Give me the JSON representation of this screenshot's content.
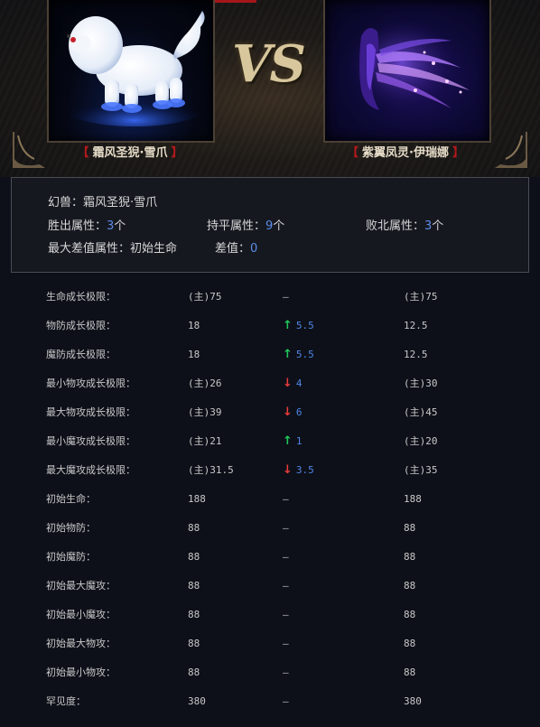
{
  "header": {
    "vs_text": "VS",
    "left_pet": {
      "bracket_open": "【",
      "name": "霜风圣猊·雪爪",
      "bracket_close": "】"
    },
    "right_pet": {
      "bracket_open": "【",
      "name": "紫翼凤灵·伊瑞娜",
      "bracket_close": "】"
    },
    "colors": {
      "bracket": "#b3181c",
      "name": "#e6dcc8",
      "vs": "#d8c79d"
    }
  },
  "summary": {
    "pet_label": "幻兽：",
    "pet_name": "霜风圣猊·雪爪",
    "win_label": "胜出属性：",
    "win_count": "3",
    "win_unit": "个",
    "tie_label": "持平属性：",
    "tie_count": "9",
    "tie_unit": "个",
    "lose_label": "败北属性：",
    "lose_count": "3",
    "lose_unit": "个",
    "max_diff_label": "最大差值属性：",
    "max_diff_attr": "初始生命",
    "diff_label": "差值：",
    "diff_value": "0"
  },
  "stats": [
    {
      "label": "生命成长极限：",
      "left": "(主)75",
      "dir": "",
      "diff": "–",
      "right": "(主)75"
    },
    {
      "label": "物防成长极限：",
      "left": "18",
      "dir": "up",
      "diff": "5.5",
      "right": "12.5"
    },
    {
      "label": "魔防成长极限：",
      "left": "18",
      "dir": "up",
      "diff": "5.5",
      "right": "12.5"
    },
    {
      "label": "最小物攻成长极限：",
      "left": "(主)26",
      "dir": "down",
      "diff": "4",
      "right": "(主)30"
    },
    {
      "label": "最大物攻成长极限：",
      "left": "(主)39",
      "dir": "down",
      "diff": "6",
      "right": "(主)45"
    },
    {
      "label": "最小魔攻成长极限：",
      "left": "(主)21",
      "dir": "up",
      "diff": "1",
      "right": "(主)20"
    },
    {
      "label": "最大魔攻成长极限：",
      "left": "(主)31.5",
      "dir": "down",
      "diff": "3.5",
      "right": "(主)35"
    },
    {
      "label": "初始生命：",
      "left": "188",
      "dir": "",
      "diff": "–",
      "right": "188"
    },
    {
      "label": "初始物防：",
      "left": "88",
      "dir": "",
      "diff": "–",
      "right": "88"
    },
    {
      "label": "初始魔防：",
      "left": "88",
      "dir": "",
      "diff": "–",
      "right": "88"
    },
    {
      "label": "初始最大魔攻：",
      "left": "88",
      "dir": "",
      "diff": "–",
      "right": "88"
    },
    {
      "label": "初始最小魔攻：",
      "left": "88",
      "dir": "",
      "diff": "–",
      "right": "88"
    },
    {
      "label": "初始最大物攻：",
      "left": "88",
      "dir": "",
      "diff": "–",
      "right": "88"
    },
    {
      "label": "初始最小物攻：",
      "left": "88",
      "dir": "",
      "diff": "–",
      "right": "88"
    },
    {
      "label": "罕见度：",
      "left": "380",
      "dir": "",
      "diff": "–",
      "right": "380"
    }
  ],
  "icons": {
    "up": "arrow-up-icon",
    "down": "arrow-down-icon"
  },
  "arrow_chars": {
    "up": "↑",
    "down": "↓"
  }
}
